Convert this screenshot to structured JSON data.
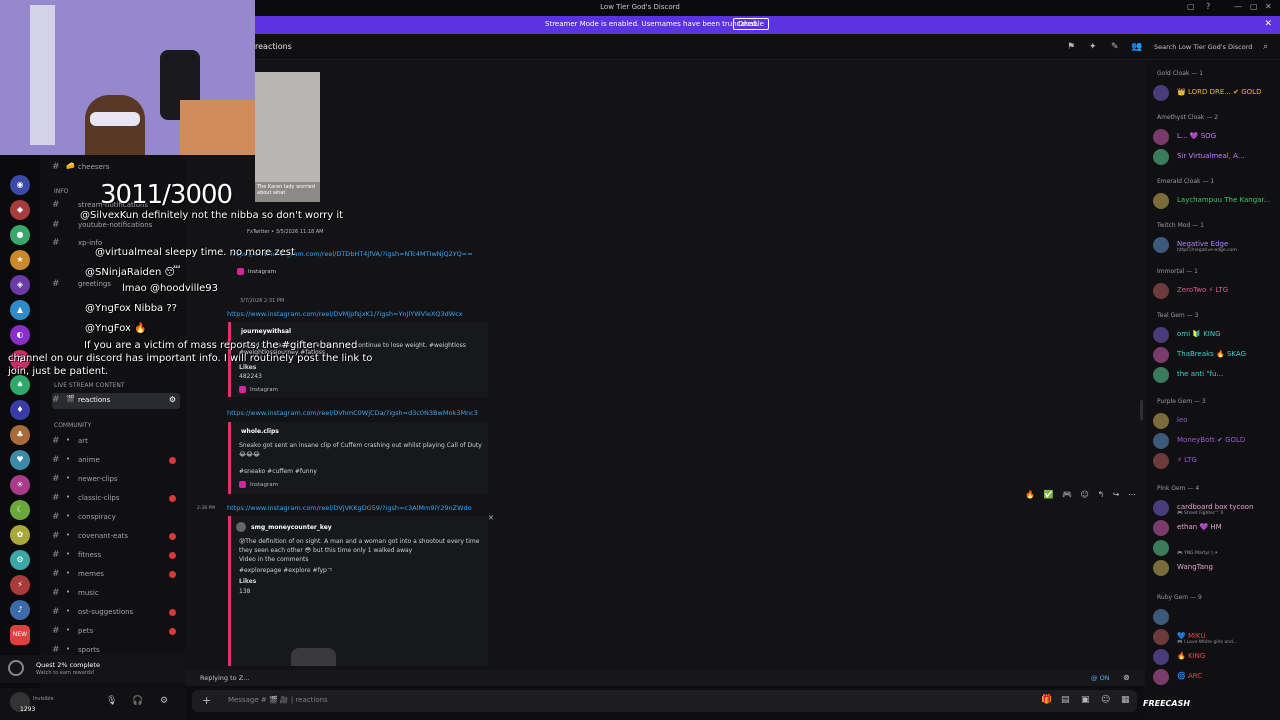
{
  "window": {
    "title": "Low Tier God's Discord"
  },
  "banner": {
    "message": "Streamer Mode is enabled. Usernames have been truncated.",
    "disable_label": "Disable"
  },
  "header": {
    "channel": "reactions",
    "search_placeholder": "Search Low Tier God's Discord"
  },
  "overlay": {
    "counter": "3011/3000",
    "lines": [
      "@SilvexKun definitely not the nibba so don't worry it",
      "@virtualmeal sleepy time. no more zest",
      "@SNinjaRaiden 😴",
      "lmao @hoodville93",
      "@YngFox Nibba ??",
      "@YngFox 🔥",
      "If you are a victim of mass reports, the #gifter-banned",
      "channel on our discord has important info. I will routinely post the link to",
      "join, just be patient."
    ]
  },
  "sidebar": {
    "categories": {
      "info": "INFO",
      "live": "LIVE STREAM CONTENT",
      "community": "COMMUNITY"
    },
    "top_channels": [
      {
        "label": "cheesers"
      },
      {
        "label": "stream-notifications"
      },
      {
        "label": "youtube-notifications"
      },
      {
        "label": "xp-info"
      },
      {
        "label": "greetings"
      }
    ],
    "live_channels": [
      {
        "label": "reactions"
      }
    ],
    "community_channels": [
      {
        "label": "art"
      },
      {
        "label": "anime"
      },
      {
        "label": "newer-clips"
      },
      {
        "label": "classic-clips"
      },
      {
        "label": "conspiracy"
      },
      {
        "label": "covenant-eats"
      },
      {
        "label": "fitness"
      },
      {
        "label": "memes"
      },
      {
        "label": "music"
      },
      {
        "label": "ost-suggestions"
      },
      {
        "label": "pets"
      },
      {
        "label": "sports"
      }
    ],
    "quest": {
      "title": "Quest 2% complete",
      "sub": "Watch to earn rewards!"
    },
    "user": {
      "status": "Invisible",
      "count": "1293"
    }
  },
  "messages": {
    "img_caption": "The Karen lady worried about what",
    "fx_meta": "FxTwitter • 3/5/2026 11:18 AM",
    "link1": "https://www.instagram.com/reel/DTDbHT4jfVA/?igsh=NTc4MTIwNjQ2YQ==",
    "insta": "Instagram",
    "time2": "3/7/2026 2:31 PM",
    "link2": "https://www.instagram.com/reel/DVMjpfsjxK1/?igsh=YnJlYWVleXQ3dWcx",
    "e2_author": "journeywithsal",
    "e2_desc": "...ward to is learning how to dress as I continue to lose weight. #weightloss #weightlossjourney #fatloss",
    "e2_likes_label": "Likes",
    "e2_likes": "482243",
    "link3": "https://www.instagram.com/reel/DVhmC0WjCDa/?igsh=d3c0N3BwMnk3Mnc3",
    "e3_author": "whole.clips",
    "e3_desc": "Sneako got sent an insane clip of Cuffem crashing out whilst playing Call of Duty",
    "e3_emoji": "😂😂😂",
    "e3_tags": "#sneako #cuffem #funny",
    "time4": "2:38 PM",
    "link4": "https://www.instagram.com/reel/DVjVKKgDG59/?igsh=c3AlMm9iY29nZWdo",
    "e4_author": "smg_moneycounter_key",
    "e4_desc1": "😰The definition of on sight. A man and a woman got into a shootout every time",
    "e4_desc2": "they seen each other 😳 but this time only 1 walked away",
    "e4_desc3": "Video in the comments",
    "e4_desc4": "#explorepage #explore #fypㄱ",
    "e4_likes_label": "Likes",
    "e4_likes": "138"
  },
  "reply": {
    "text": "Replying to Z...",
    "mention": "@ ON"
  },
  "composer": {
    "placeholder": "Message # 🎬 🎥 | reactions"
  },
  "members": {
    "roles": [
      {
        "name": "Gold Cloak — 1"
      },
      {
        "name": "Amethyst Cloak — 2"
      },
      {
        "name": "Emerald Cloak — 1"
      },
      {
        "name": "Twitch Mod — 1"
      },
      {
        "name": "Immortal — 1"
      },
      {
        "name": "Teal Gem — 3"
      },
      {
        "name": "Purple Gem — 3"
      },
      {
        "name": "Pink Gem — 4"
      },
      {
        "name": "Ruby Gem — 9"
      }
    ],
    "list": [
      {
        "name": "👑 LORD DRE... ✔ GOLD",
        "color": "#f0b232"
      },
      {
        "name": "L... 💜 SOG",
        "color": "#c77dff"
      },
      {
        "name": "Sir Virtualmeal, A...",
        "color": "#c77dff"
      },
      {
        "name": "Laychampuu The Kangar...",
        "color": "#3ec46d"
      },
      {
        "name": "Negative Edge",
        "color": "#b085f5",
        "sub": "https://negative-edge.com"
      },
      {
        "name": "ZeroTwo ⚡ LTG",
        "color": "#e0598b"
      },
      {
        "name": "omi 🔰 KING",
        "color": "#3ecfcf"
      },
      {
        "name": "ThaBreaks 🔥 SKAG",
        "color": "#3ecfcf"
      },
      {
        "name": "the anti \"fu...",
        "color": "#3ecfcf"
      },
      {
        "name": "leo",
        "color": "#9b59d0"
      },
      {
        "name": "MoneyBott ✔ GOLD",
        "color": "#9b59d0"
      },
      {
        "name": "⚡ LTG",
        "color": "#9b59d0"
      },
      {
        "name": "cardboard box tycoon",
        "color": "#e8a0d0",
        "sub": "🎮 Street Fighter™ 6"
      },
      {
        "name": "ethan 💜 HM",
        "color": "#e8a0d0"
      },
      {
        "name": "",
        "color": "#e8a0d0",
        "sub": "🎮 YNG Martyr | ✈"
      },
      {
        "name": "WangTang",
        "color": "#e8a0d0"
      },
      {
        "name": "",
        "color": "#e04848"
      },
      {
        "name": "💙 MIKU",
        "color": "#e04848",
        "sub": "🎮 I Love White girls and..."
      },
      {
        "name": "🔥 KING",
        "color": "#e04848"
      },
      {
        "name": "🌀 ARC",
        "color": "#e04848"
      }
    ]
  },
  "watermark": "FREECASH"
}
